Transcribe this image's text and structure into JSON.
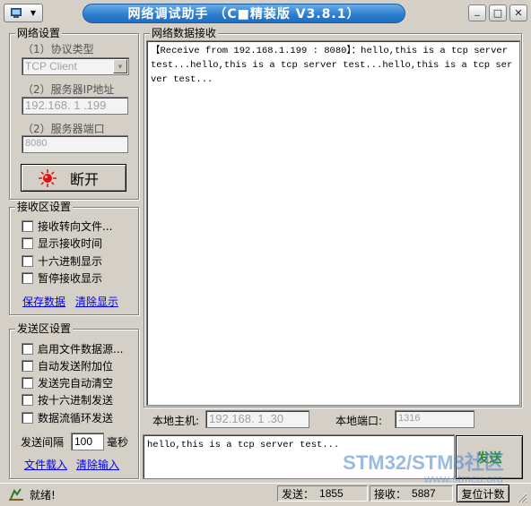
{
  "window": {
    "title": "网络调试助手 （C■精装版 V3.8.1）",
    "sysmenu_icon": "app-icon",
    "sysmenu_arrow": "▼",
    "minimize": "_",
    "maximize": "□",
    "close": "✕"
  },
  "net_settings": {
    "legend": "网络设置",
    "protocol_label": "（1）协议类型",
    "protocol_value": "TCP Client",
    "ip_label": "（2）服务器IP地址",
    "ip_value": "192.168. 1 .199",
    "port_label": "（2）服务器端口",
    "port_value": "8080",
    "connect_button": "断开",
    "connect_icon": "connection-status-icon",
    "connect_icon_color": "#e01010"
  },
  "recv_settings": {
    "legend": "接收区设置",
    "options": [
      "接收转向文件...",
      "显示接收时间",
      "十六进制显示",
      "暂停接收显示"
    ],
    "save_link": "保存数据",
    "clear_link": "清除显示"
  },
  "send_settings": {
    "legend": "发送区设置",
    "options": [
      "启用文件数据源...",
      "自动发送附加位",
      "发送完自动清空",
      "按十六进制发送",
      "数据流循环发送"
    ],
    "interval_label": "发送间隔",
    "interval_value": "100",
    "interval_unit": "毫秒",
    "load_link": "文件载入",
    "clear_link": "清除输入"
  },
  "receive_area": {
    "legend": "网络数据接收",
    "text": "【Receive from 192.168.1.199 : 8080】：hello,this is a tcp server test...hello,this is a tcp server test...hello,this is a tcp server test..."
  },
  "local_info": {
    "host_label": "本地主机:",
    "host_value": "192.168. 1 .30",
    "port_label": "本地端口:",
    "port_value": "1316"
  },
  "send_area": {
    "text": "hello,this is a tcp server test...",
    "send_button": "发送",
    "send_color": "#2a8a2a"
  },
  "status_bar": {
    "status_icon": "status-icon",
    "status_text": "就绪!",
    "sent_label": "发送：",
    "sent_value": "1855",
    "recv_label": "接收：",
    "recv_value": "5887",
    "reset_button": "复位计数"
  },
  "watermark": {
    "text": "STM32/STM8社区",
    "subtext": "www.stmcu.org"
  }
}
